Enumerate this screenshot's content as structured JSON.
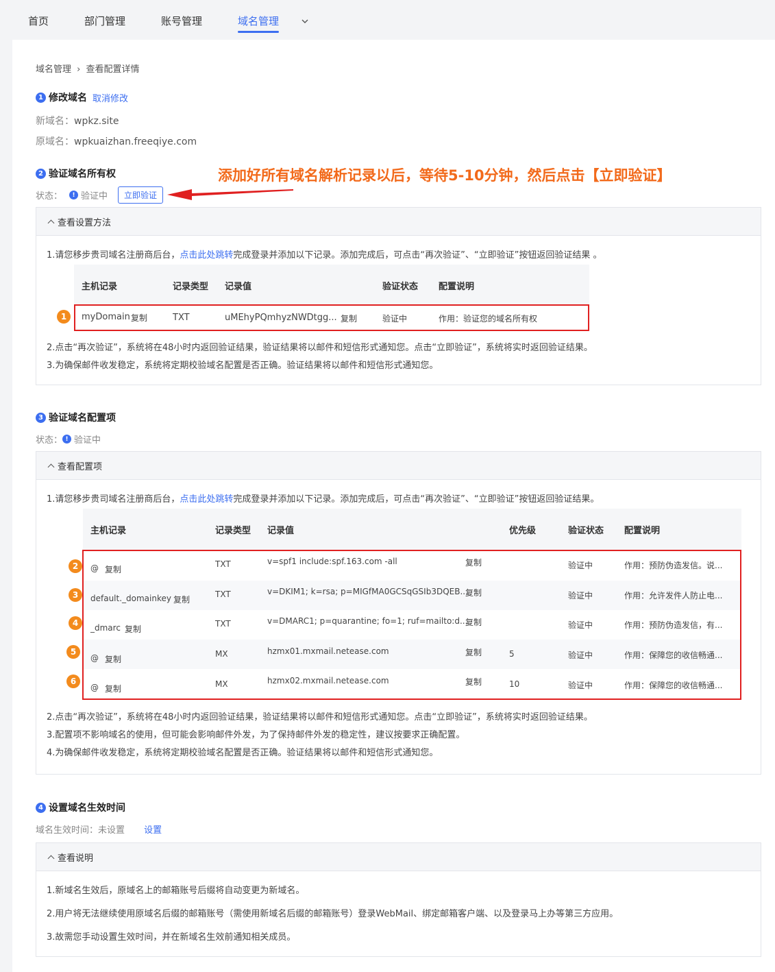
{
  "nav": {
    "items": [
      "首页",
      "部门管理",
      "账号管理",
      "域名管理"
    ],
    "active": "域名管理"
  },
  "breadcrumb": {
    "parent": "域名管理",
    "sep": "›",
    "current": "查看配置详情"
  },
  "step1": {
    "num": "1",
    "title": "修改域名",
    "cancel": "取消修改",
    "new_label": "新域名：",
    "new_value": "wpkz.site",
    "old_label": "原域名：",
    "old_value": "wpkuaizhan.freeqiye.com"
  },
  "step2": {
    "num": "2",
    "title": "验证域名所有权",
    "status_label": "状态：",
    "status_value": "验证中",
    "verify_btn": "立即验证",
    "panel_title": "查看设置方法",
    "line1_a": "1.请您移步贵司域名注册商后台，",
    "line1_link": "点击此处跳转",
    "line1_b": "完成登录并添加以下记录。添加完成后，可点击“再次验证”、“立即验证”按钮返回验证结果 。",
    "line2": "2.点击“再次验证”，系统将在48小时内返回验证结果，验证结果将以邮件和短信形式通知您。点击“立即验证”，系统将实时返回验证结果。",
    "line3": "3.为确保邮件收发稳定，系统将定期校验域名配置是否正确。验证结果将以邮件和短信形式通知您。",
    "headers": [
      "主机记录",
      "记录类型",
      "记录值",
      "验证状态",
      "配置说明"
    ],
    "row": {
      "host": "myDomain",
      "copy": "复制",
      "type": "TXT",
      "value": "uMEhyPQmhyzNWDtgg...",
      "copy2": "复制",
      "status": "验证中",
      "desc": "作用：验证您的域名所有权"
    }
  },
  "annotation": {
    "text": "添加好所有域名解析记录以后，等待5-10分钟，然后点击【立即验证】",
    "circle_nums": [
      "1",
      "2",
      "3",
      "4",
      "5",
      "6"
    ]
  },
  "step3": {
    "num": "3",
    "title": "验证域名配置项",
    "status_label": "状态：",
    "status_value": "验证中",
    "panel_title": "查看配置项",
    "line1_a": "1.请您移步贵司域名注册商后台，",
    "line1_link": "点击此处跳转",
    "line1_b": "完成登录并添加以下记录。添加完成后，可点击“再次验证”、“立即验证”按钮返回验证结果。",
    "line2": "2.点击“再次验证”，系统将在48小时内返回验证结果，验证结果将以邮件和短信形式通知您。点击“立即验证”，系统将实时返回验证结果。",
    "line3": "3.配置项不影响域名的使用，但可能会影响邮件外发，为了保持邮件外发的稳定性，建议按要求正确配置。",
    "line4": "4.为确保邮件收发稳定，系统将定期校验域名配置是否正确。验证结果将以邮件和短信形式通知您。",
    "headers": [
      "主机记录",
      "记录类型",
      "记录值",
      "优先级",
      "验证状态",
      "配置说明"
    ],
    "rows": [
      {
        "host": "@",
        "copy": "复制",
        "type": "TXT",
        "value": "v=spf1 include:spf.163.com -all",
        "copy2": "复制",
        "priority": "",
        "status": "验证中",
        "desc": "作用：预防伪造发信。说..."
      },
      {
        "host": "default._domainkey",
        "copy": "复制",
        "type": "TXT",
        "value": "v=DKIM1; k=rsa; p=MIGfMA0GCSqGSIb3DQEB...",
        "copy2": "复制",
        "priority": "",
        "status": "验证中",
        "desc": "作用：允许发件人防止电..."
      },
      {
        "host": "_dmarc",
        "copy": "复制",
        "type": "TXT",
        "value": "v=DMARC1; p=quarantine; fo=1; ruf=mailto:d...",
        "copy2": "复制",
        "priority": "",
        "status": "验证中",
        "desc": "作用：预防伪造发信，有..."
      },
      {
        "host": "@",
        "copy": "复制",
        "type": "MX",
        "value": "hzmx01.mxmail.netease.com",
        "copy2": "复制",
        "priority": "5",
        "status": "验证中",
        "desc": "作用：保障您的收信畅通..."
      },
      {
        "host": "@",
        "copy": "复制",
        "type": "MX",
        "value": "hzmx02.mxmail.netease.com",
        "copy2": "复制",
        "priority": "10",
        "status": "验证中",
        "desc": "作用：保障您的收信畅通..."
      }
    ]
  },
  "step4": {
    "num": "4",
    "title": "设置域名生效时间",
    "label": "域名生效时间：",
    "value": "未设置",
    "set_link": "设置",
    "panel_title": "查看说明",
    "line1": "1.新域名生效后，原域名上的邮箱账号后缀将自动变更为新域名。",
    "line2": "2.用户将无法继续使用原域名后缀的邮箱账号（需使用新域名后缀的邮箱账号）登录WebMail、绑定邮箱客户端、以及登录马上办等第三方应用。",
    "line3": "3.故需您手动设置生效时间，并在新域名生效前通知相关成员。"
  }
}
